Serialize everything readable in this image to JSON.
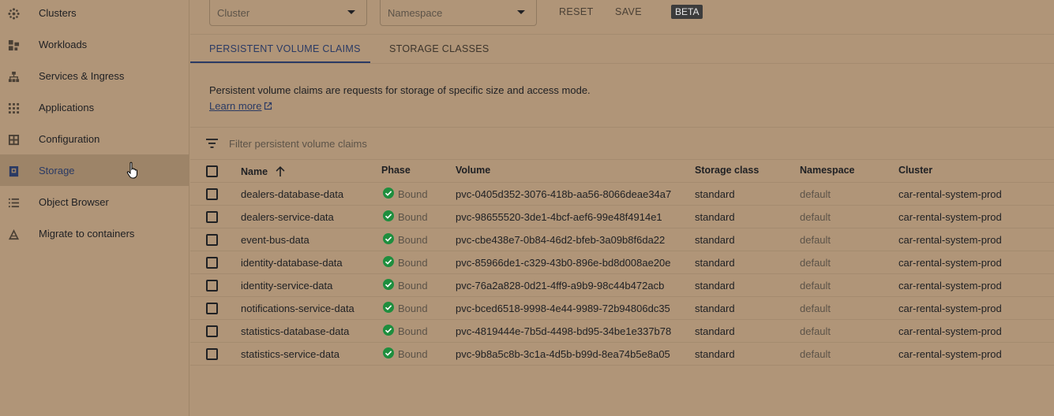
{
  "sidebar": {
    "items": [
      {
        "label": "Clusters",
        "icon": "clusters-icon"
      },
      {
        "label": "Workloads",
        "icon": "workloads-icon"
      },
      {
        "label": "Services & Ingress",
        "icon": "services-icon"
      },
      {
        "label": "Applications",
        "icon": "applications-icon"
      },
      {
        "label": "Configuration",
        "icon": "configuration-icon"
      },
      {
        "label": "Storage",
        "icon": "storage-icon",
        "active": true
      },
      {
        "label": "Object Browser",
        "icon": "object-browser-icon"
      },
      {
        "label": "Migrate to containers",
        "icon": "migrate-icon"
      }
    ]
  },
  "toolbar": {
    "cluster_placeholder": "Cluster",
    "namespace_placeholder": "Namespace",
    "reset_label": "RESET",
    "save_label": "SAVE",
    "beta_label": "BETA"
  },
  "tabs": [
    {
      "label": "PERSISTENT VOLUME CLAIMS",
      "active": true
    },
    {
      "label": "STORAGE CLASSES",
      "active": false
    }
  ],
  "description": "Persistent volume claims are requests for storage of specific size and access mode.",
  "learn_more": "Learn more",
  "filter": {
    "placeholder": "Filter persistent volume claims"
  },
  "table": {
    "columns": [
      "Name",
      "Phase",
      "Volume",
      "Storage class",
      "Namespace",
      "Cluster"
    ],
    "sort_column": "Name",
    "rows": [
      {
        "name": "dealers-database-data",
        "phase": "Bound",
        "volume": "pvc-0405d352-3076-418b-aa56-8066deae34a7",
        "storage_class": "standard",
        "namespace": "default",
        "cluster": "car-rental-system-prod"
      },
      {
        "name": "dealers-service-data",
        "phase": "Bound",
        "volume": "pvc-98655520-3de1-4bcf-aef6-99e48f4914e1",
        "storage_class": "standard",
        "namespace": "default",
        "cluster": "car-rental-system-prod"
      },
      {
        "name": "event-bus-data",
        "phase": "Bound",
        "volume": "pvc-cbe438e7-0b84-46d2-bfeb-3a09b8f6da22",
        "storage_class": "standard",
        "namespace": "default",
        "cluster": "car-rental-system-prod"
      },
      {
        "name": "identity-database-data",
        "phase": "Bound",
        "volume": "pvc-85966de1-c329-43b0-896e-bd8d008ae20e",
        "storage_class": "standard",
        "namespace": "default",
        "cluster": "car-rental-system-prod"
      },
      {
        "name": "identity-service-data",
        "phase": "Bound",
        "volume": "pvc-76a2a828-0d21-4ff9-a9b9-98c44b472acb",
        "storage_class": "standard",
        "namespace": "default",
        "cluster": "car-rental-system-prod"
      },
      {
        "name": "notifications-service-data",
        "phase": "Bound",
        "volume": "pvc-bced6518-9998-4e44-9989-72b94806dc35",
        "storage_class": "standard",
        "namespace": "default",
        "cluster": "car-rental-system-prod"
      },
      {
        "name": "statistics-database-data",
        "phase": "Bound",
        "volume": "pvc-4819444e-7b5d-4498-bd95-34be1e337b78",
        "storage_class": "standard",
        "namespace": "default",
        "cluster": "car-rental-system-prod"
      },
      {
        "name": "statistics-service-data",
        "phase": "Bound",
        "volume": "pvc-9b8a5c8b-3c1a-4d5b-b99d-8ea74b5e8a05",
        "storage_class": "standard",
        "namespace": "default",
        "cluster": "car-rental-system-prod"
      }
    ]
  },
  "colors": {
    "background": "#b09578",
    "active_nav": "#9d8468",
    "accent": "#2a3a64",
    "status_ok": "#1e8e3e"
  }
}
